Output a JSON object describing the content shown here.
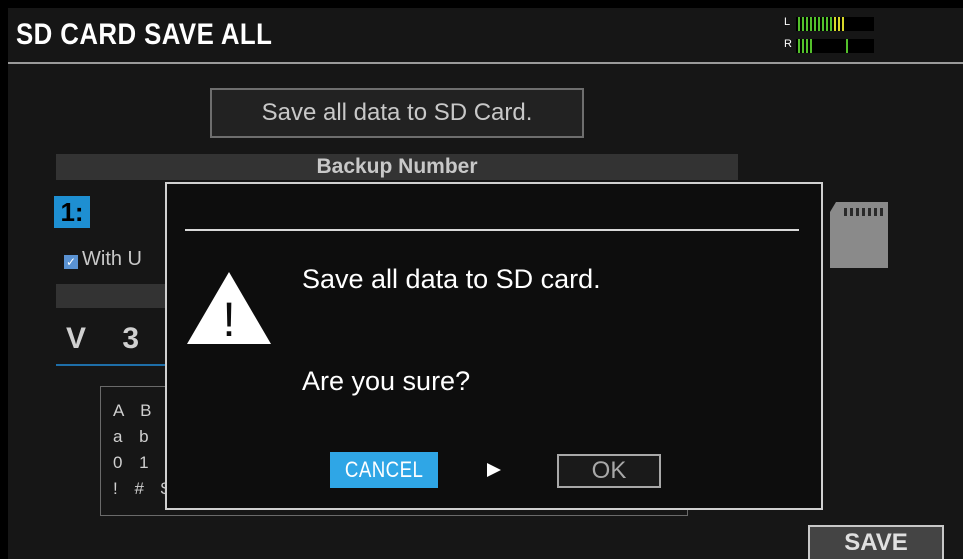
{
  "header": {
    "title": "SD CARD SAVE ALL",
    "meter": {
      "left_label": "L",
      "right_label": "R"
    }
  },
  "content": {
    "save_all_label": "Save all data to SD Card.",
    "backup_number_label": "Backup Number",
    "backup_index": "1:",
    "with_user_label": "With U",
    "name_value": "V 3 1",
    "char_rows": [
      "A B (",
      "a b (",
      "0 1 2",
      "! # $"
    ]
  },
  "dialog": {
    "message_line1": "Save all data to SD card.",
    "message_line2": "Are you sure?",
    "cancel_label": "CANCEL",
    "ok_label": "OK",
    "warning_glyph": "!"
  },
  "footer": {
    "save_label": "SAVE"
  },
  "colors": {
    "accent": "#2fa6e6",
    "index_bg": "#1e8fd2",
    "meter_green": "#53c02b",
    "meter_yellow": "#d8d82a"
  },
  "icons": [
    "warning-icon",
    "sd-card-icon",
    "right-arrow-icon",
    "checkbox-icon"
  ]
}
